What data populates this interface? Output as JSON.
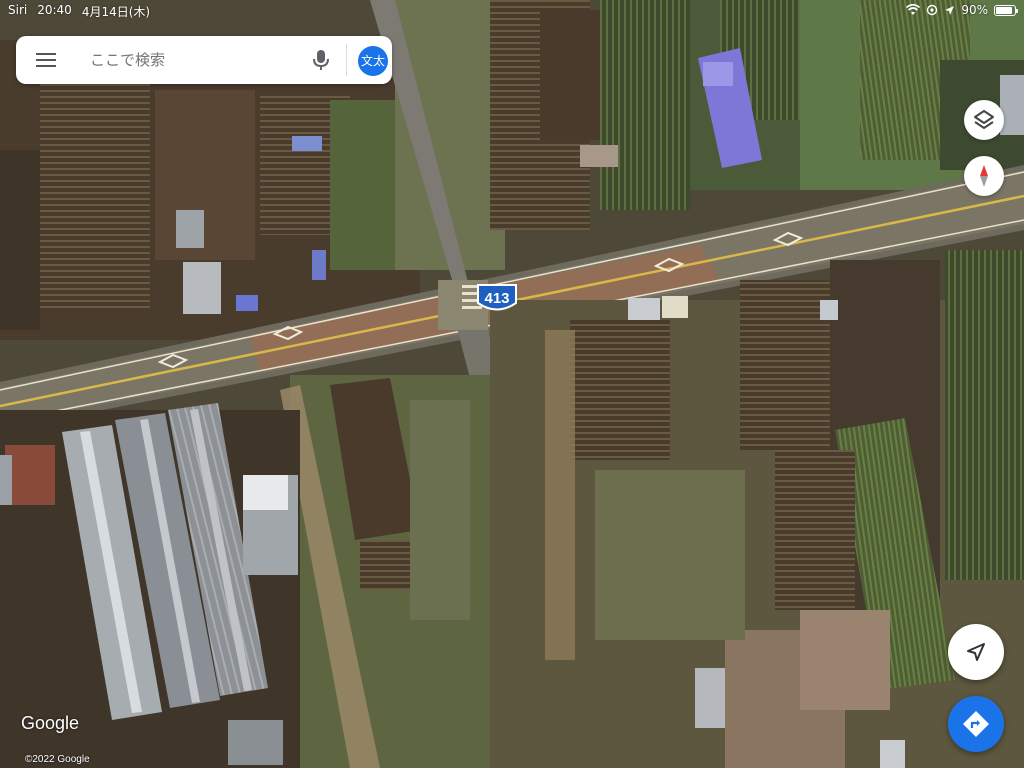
{
  "statusbar": {
    "carrier": "Siri",
    "time": "20:40",
    "date": "4月14日(木)",
    "battery": "90%",
    "battery_level": 0.9
  },
  "search": {
    "placeholder": "ここで検索",
    "account_label": "文太"
  },
  "map": {
    "mode": "satellite",
    "route_number": "413",
    "alt": "Satellite view of farmland plots crossed by a two-lane road with a yellow centre line; a greenhouse cluster at lower left."
  },
  "controls": {
    "layers_icon": "layers-icon",
    "compass_icon": "compass-icon",
    "location_icon": "navigation-arrow-icon",
    "directions_icon": "directions-icon",
    "directions_color": "#1a73e8"
  },
  "attribution": {
    "logo": "Google",
    "copyright": "©2022 Google"
  }
}
